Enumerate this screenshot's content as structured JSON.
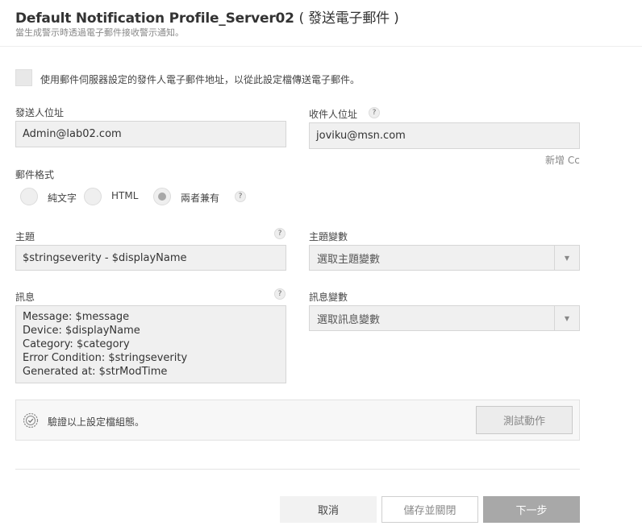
{
  "header": {
    "title_main": "Default Notification Profile_Server02",
    "title_suffix": "( 發送電子郵件 )",
    "subtitle": "當生成警示時透過電子郵件接收警示通知。"
  },
  "use_server_sender": {
    "label": "使用郵件伺服器設定的發件人電子郵件地址，以從此設定檔傳送電子郵件。",
    "checked": false
  },
  "sender": {
    "label": "發送人位址",
    "value": "Admin@lab02.com"
  },
  "recipient": {
    "label": "收件人位址",
    "help": "?",
    "value": "joviku@msn.com",
    "add_cc": "新增 Cc"
  },
  "format": {
    "label": "郵件格式",
    "options": [
      "純文字",
      "HTML",
      "兩者兼有"
    ],
    "selected": "兩者兼有",
    "help": "?"
  },
  "subject": {
    "label": "主題",
    "help": "?",
    "value": "$stringseverity - $displayName"
  },
  "subject_var": {
    "label": "主題變數",
    "placeholder": "選取主題變數"
  },
  "message": {
    "label": "訊息",
    "help": "?",
    "lines": [
      "Message: $message",
      "Device: $displayName",
      "Category: $category",
      "Error Condition: $stringseverity",
      "Generated at: $strModTime"
    ]
  },
  "message_var": {
    "label": "訊息變數",
    "placeholder": "選取訊息變數"
  },
  "verify": {
    "label": "驗證以上設定檔組態。",
    "test_button": "測試動作"
  },
  "footer": {
    "cancel": "取消",
    "save_close": "儲存並關閉",
    "next": "下一步"
  },
  "colors": {
    "next_button_bg": "#a8a8a8",
    "field_bg": "#f0f0f0"
  }
}
